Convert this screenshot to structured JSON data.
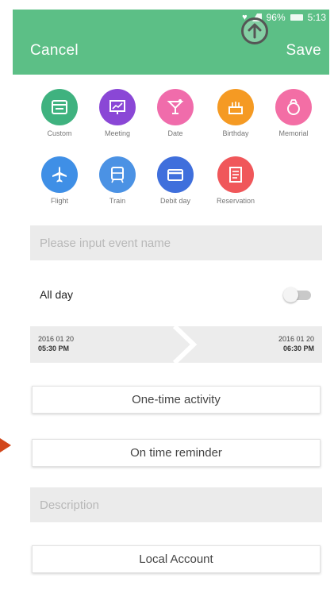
{
  "status_bar": {
    "time": "5:13",
    "battery": "96%"
  },
  "header": {
    "cancel": "Cancel",
    "save": "Save"
  },
  "categories": [
    {
      "label": "Custom",
      "color": "#3fb27f",
      "icon": "window-icon"
    },
    {
      "label": "Meeting",
      "color": "#8a47d6",
      "icon": "presentation-icon"
    },
    {
      "label": "Date",
      "color": "#f06cab",
      "icon": "cocktail-icon"
    },
    {
      "label": "Birthday",
      "color": "#f59a23",
      "icon": "cake-icon"
    },
    {
      "label": "Memorial",
      "color": "#f36ea5",
      "icon": "ring-icon"
    },
    {
      "label": "Flight",
      "color": "#3f8fe6",
      "icon": "airplane-icon"
    },
    {
      "label": "Train",
      "color": "#4b92e4",
      "icon": "train-icon"
    },
    {
      "label": "Debit day",
      "color": "#3f6fdc",
      "icon": "card-icon"
    },
    {
      "label": "Reservation",
      "color": "#f0575a",
      "icon": "receipt-icon"
    }
  ],
  "form": {
    "event_name_placeholder": "Please input event name",
    "all_day_label": "All day",
    "all_day_on": false,
    "start_date": "2016 01 20",
    "start_time": "05:30 PM",
    "end_date": "2016 01 20",
    "end_time": "06:30 PM",
    "repeat": "One-time activity",
    "reminder": "On time reminder",
    "description_placeholder": "Description",
    "account": "Local Account"
  },
  "colors": {
    "header": "#5cbf86",
    "pointer_arrow": "#d2471c"
  }
}
